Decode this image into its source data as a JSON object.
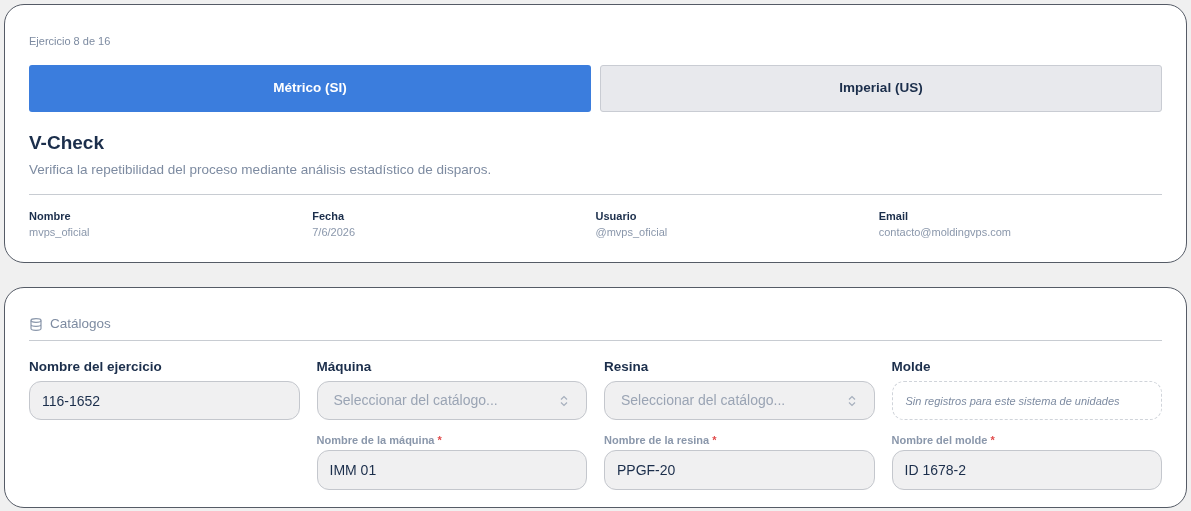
{
  "exercise_counter": "Ejercicio 8 de 16",
  "unit_tabs": [
    {
      "label": "Métrico (SI)",
      "selected": true
    },
    {
      "label": "Imperial (US)",
      "selected": false
    }
  ],
  "title": "V-Check",
  "description": "Verifica la repetibilidad del proceso mediante análisis estadístico de disparos.",
  "info": [
    {
      "label": "Nombre",
      "value": "mvps_oficial"
    },
    {
      "label": "Fecha",
      "value": "7/6/2026"
    },
    {
      "label": "Usuario",
      "value": "@mvps_oficial"
    },
    {
      "label": "Email",
      "value": "contacto@moldingvps.com"
    }
  ],
  "catalogs": {
    "heading": "Catálogos",
    "fields": [
      {
        "kind": "input",
        "label": "Nombre del ejercicio",
        "value": "116-1652"
      },
      {
        "kind": "select",
        "label": "Máquina",
        "placeholder": "Seleccionar del catálogo...",
        "sub": {
          "label": "Nombre de la máquina",
          "required_mark": "*",
          "value": "IMM 01"
        }
      },
      {
        "kind": "select",
        "label": "Resina",
        "placeholder": "Seleccionar del catálogo...",
        "sub": {
          "label": "Nombre de la resina",
          "required_mark": "*",
          "value": "PPGF-20"
        }
      },
      {
        "kind": "empty",
        "label": "Molde",
        "message": "Sin registros para este sistema de unidades",
        "sub": {
          "label": "Nombre del molde",
          "required_mark": "*",
          "value": "ID 1678-2"
        }
      }
    ]
  }
}
